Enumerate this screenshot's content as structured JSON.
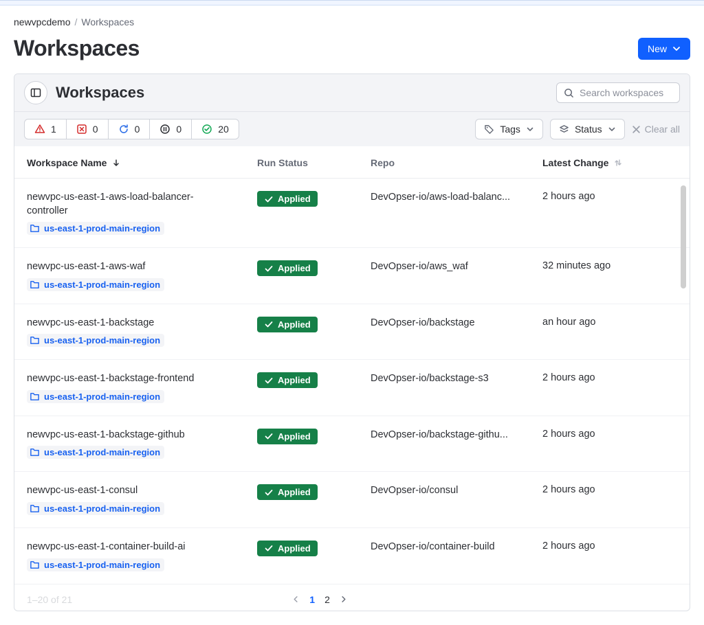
{
  "breadcrumb": {
    "root": "newvpcdemo",
    "current": "Workspaces"
  },
  "page": {
    "title": "Workspaces",
    "new_label": "New"
  },
  "view": {
    "title": "Workspaces",
    "search_placeholder": "Search workspaces",
    "filters": {
      "errored": "1",
      "failed": "0",
      "running": "0",
      "paused": "0",
      "applied": "20",
      "tags_label": "Tags",
      "status_label": "Status",
      "clear_label": "Clear all"
    }
  },
  "table": {
    "headers": {
      "name": "Workspace Name",
      "status": "Run Status",
      "repo": "Repo",
      "change": "Latest Change"
    },
    "rows": [
      {
        "name": "newvpc-us-east-1-aws-load-balancer-controller",
        "project": "us-east-1-prod-main-region",
        "status": "Applied",
        "repo": "DevOpser-io/aws-load-balanc...",
        "change": "2 hours ago"
      },
      {
        "name": "newvpc-us-east-1-aws-waf",
        "project": "us-east-1-prod-main-region",
        "status": "Applied",
        "repo": "DevOpser-io/aws_waf",
        "change": "32 minutes ago"
      },
      {
        "name": "newvpc-us-east-1-backstage",
        "project": "us-east-1-prod-main-region",
        "status": "Applied",
        "repo": "DevOpser-io/backstage",
        "change": "an hour ago"
      },
      {
        "name": "newvpc-us-east-1-backstage-frontend",
        "project": "us-east-1-prod-main-region",
        "status": "Applied",
        "repo": "DevOpser-io/backstage-s3",
        "change": "2 hours ago"
      },
      {
        "name": "newvpc-us-east-1-backstage-github",
        "project": "us-east-1-prod-main-region",
        "status": "Applied",
        "repo": "DevOpser-io/backstage-githu...",
        "change": "2 hours ago"
      },
      {
        "name": "newvpc-us-east-1-consul",
        "project": "us-east-1-prod-main-region",
        "status": "Applied",
        "repo": "DevOpser-io/consul",
        "change": "2 hours ago"
      },
      {
        "name": "newvpc-us-east-1-container-build-ai",
        "project": "us-east-1-prod-main-region",
        "status": "Applied",
        "repo": "DevOpser-io/container-build",
        "change": "2 hours ago"
      }
    ]
  },
  "pagination": {
    "range": "1–20 of 21",
    "page1": "1",
    "page2": "2"
  }
}
